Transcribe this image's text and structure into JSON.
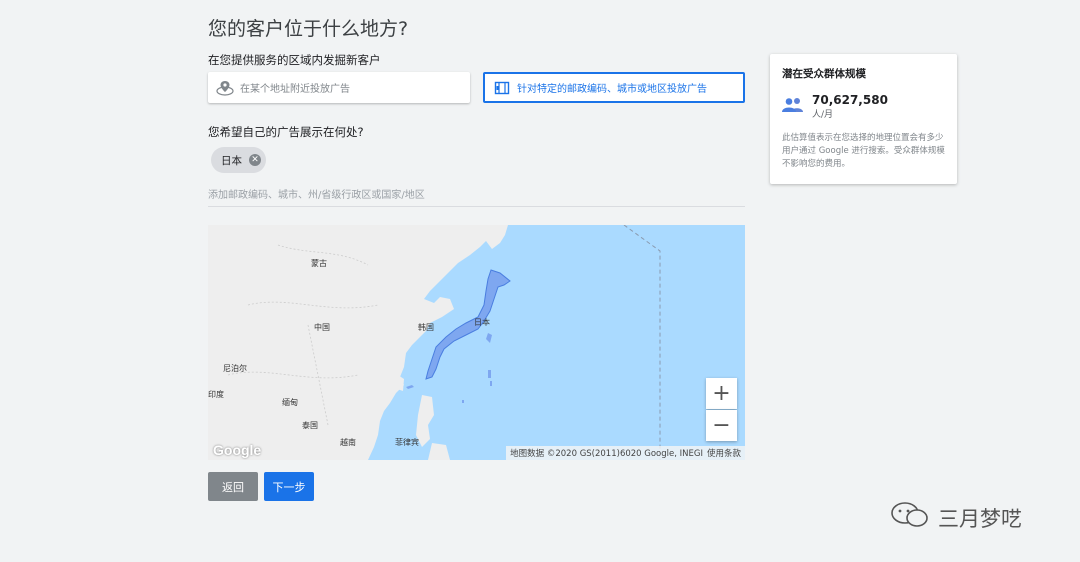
{
  "page": {
    "title": "您的客户位于什么地方?",
    "section1_label": "在您提供服务的区域内发掘新客户",
    "section2_label": "您希望自己的广告展示在何处?"
  },
  "options": {
    "nearby": "在某个地址附近投放广告",
    "targeted": "针对特定的邮政编码、城市或地区投放广告"
  },
  "chip": {
    "label": "日本",
    "remove_glyph": "✕"
  },
  "location_input": {
    "placeholder": "添加邮政编码、城市、州/省级行政区或国家/地区"
  },
  "map": {
    "labels": {
      "mongolia": "蒙古",
      "china": "中国",
      "korea": "韩国",
      "japan": "日本",
      "nepal": "尼泊尔",
      "india": "印度",
      "myanmar": "缅甸",
      "thailand": "泰国",
      "vietnam": "越南",
      "philippines": "菲律宾"
    },
    "zoom_in": "+",
    "zoom_out": "−",
    "logo": "Google",
    "attribution": "地图数据 ©2020 GS(2011)6020 Google, INEGI",
    "terms": "使用条款"
  },
  "buttons": {
    "back": "返回",
    "next": "下一步"
  },
  "audience": {
    "title": "潜在受众群体规模",
    "count": "70,627,580",
    "unit": "人/月",
    "description": "此估算值表示在您选择的地理位置会有多少用户通过 Google 进行搜索。受众群体规模不影响您的费用。"
  },
  "watermark": {
    "text": "三月梦呓"
  },
  "colors": {
    "accent": "#1a73e8",
    "water": "#aadaff",
    "land": "#eeeeee",
    "selected_region": "#7ea7f0"
  }
}
